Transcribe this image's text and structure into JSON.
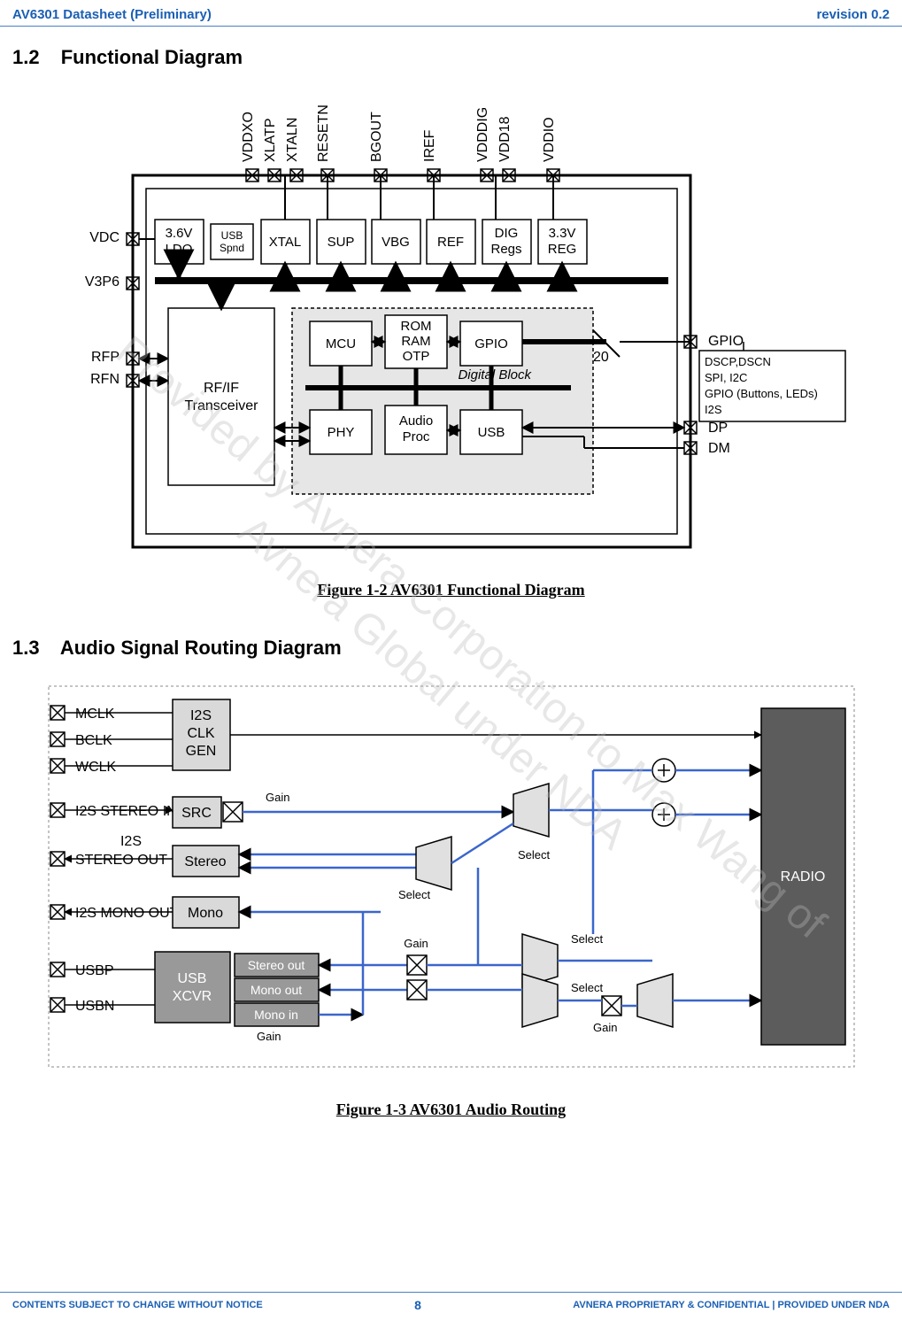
{
  "header": {
    "left": "AV6301 Datasheet (Preliminary)",
    "right": "revision 0.2"
  },
  "sections": {
    "s1_2_num": "1.2",
    "s1_2_title": "Functional Diagram",
    "s1_3_num": "1.3",
    "s1_3_title": "Audio Signal Routing Diagram"
  },
  "figures": {
    "f1_2": "Figure 1-2 AV6301 Functional Diagram",
    "f1_3": "Figure 1-3 AV6301 Audio Routing"
  },
  "diagram1": {
    "top_pins": [
      "VDDXO",
      "XLATP",
      "XTALN",
      "RESETN",
      "BGOUT",
      "IREF",
      "VDDDIG",
      "VDD18",
      "VDDIO"
    ],
    "left_pins": [
      "VDC",
      "V3P6",
      "RFP",
      "RFN"
    ],
    "right_pins": {
      "gpio": "GPIO",
      "gpio_count": "20",
      "dp": "DP",
      "dm": "DM"
    },
    "blocks_top": [
      {
        "l1": "3.6V",
        "l2": "LDO"
      },
      {
        "l1": "USB",
        "l2": "Spnd"
      },
      {
        "l1": "XTAL",
        "l2": ""
      },
      {
        "l1": "SUP",
        "l2": ""
      },
      {
        "l1": "VBG",
        "l2": ""
      },
      {
        "l1": "REF",
        "l2": ""
      },
      {
        "l1": "DIG",
        "l2": "Regs"
      },
      {
        "l1": "3.3V",
        "l2": "REG"
      }
    ],
    "rf_block": {
      "l1": "RF/IF",
      "l2": "Transceiver"
    },
    "digital_block_label": "Digital Block",
    "digital_blocks_row1": [
      {
        "l1": "MCU"
      },
      {
        "l1": "ROM",
        "l2": "RAM",
        "l3": "OTP"
      },
      {
        "l1": "GPIO"
      }
    ],
    "digital_blocks_row2": [
      {
        "l1": "PHY"
      },
      {
        "l1": "Audio",
        "l2": "Proc"
      },
      {
        "l1": "USB"
      }
    ],
    "gpio_box": [
      "DSCP,DSCN",
      "SPI, I2C",
      "GPIO (Buttons, LEDs)",
      "I2S"
    ]
  },
  "diagram2": {
    "left_pins": [
      "MCLK",
      "BCLK",
      "WCLK",
      "I2S STEREO IN",
      "I2S",
      "STEREO OUT",
      "I2S MONO OUT",
      "USBP",
      "USBN"
    ],
    "blocks": {
      "i2s_clk": {
        "l1": "I2S",
        "l2": "CLK",
        "l3": "GEN"
      },
      "src": "SRC",
      "stereo": "Stereo",
      "mono": "Mono",
      "usb_xcvr": {
        "l1": "USB",
        "l2": "XCVR"
      },
      "stereo_out": "Stereo out",
      "mono_out": "Mono out",
      "mono_in": "Mono in",
      "radio": "RADIO"
    },
    "labels": {
      "gain": "Gain",
      "select": "Select"
    }
  },
  "watermark": {
    "line1": "Provided by Avnera Corporation to Max Wang of",
    "line2": "Avnera Global under NDA"
  },
  "footer": {
    "left": "CONTENTS SUBJECT TO CHANGE WITHOUT NOTICE",
    "page": "8",
    "right": "AVNERA PROPRIETARY & CONFIDENTIAL | PROVIDED UNDER NDA"
  }
}
